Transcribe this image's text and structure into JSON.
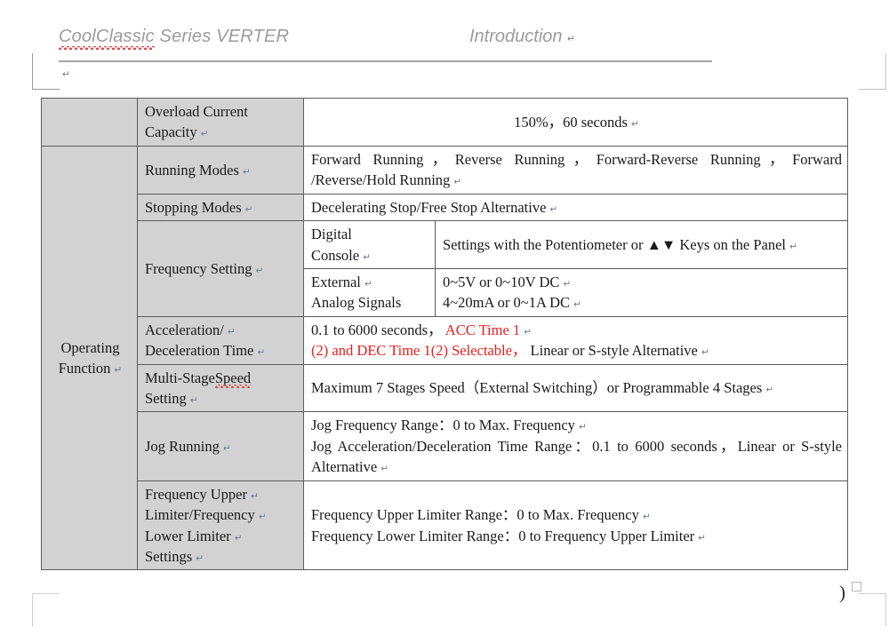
{
  "header": {
    "left_text_misspelled": "CoolClassic",
    "left_text_rest": " Series VERTER",
    "right_text": "Introduction",
    "pilcrow": "↵"
  },
  "table": {
    "row_group_label": "Operating Function",
    "rows": [
      {
        "label": "Overload Current Capacity",
        "value": "150%，60 seconds"
      },
      {
        "label": "Running Modes",
        "value": "Forward Running，Reverse Running，Forward-Reverse Running，Forward /Reverse/Hold Running"
      },
      {
        "label": "Stopping Modes",
        "value": "Decelerating Stop/Free Stop Alternative"
      },
      {
        "label": "Frequency Setting",
        "sub_rows": [
          {
            "sub_label_line1": "Digital",
            "sub_label_line2": "Console",
            "value": "Settings with the Potentiometer or ▲▼ Keys on the Panel"
          },
          {
            "sub_label_line1": "External",
            "sub_label_line2": "Analog Signals",
            "value_line1": "0~5V or 0~10V DC",
            "value_line2": "4~20mA or 0~1A DC"
          }
        ]
      },
      {
        "label_line1": "Acceleration/",
        "label_line2": "Deceleration Time",
        "value_black_1": "0.1 to 6000 seconds，",
        "value_red_1": "ACC Time 1",
        "value_red_2": "(2) and DEC Time 1(2) Selectable，",
        "value_black_2": "Linear or S-style Alternative"
      },
      {
        "label_line1_a": "Multi-Stage",
        "label_line1_b": "Speed",
        "label_line2": "Setting",
        "value": "Maximum 7 Stages Speed（External Switching）or Programmable 4 Stages"
      },
      {
        "label": "Jog Running",
        "value_line1": "Jog Frequency Range：0 to Max. Frequency",
        "value_line2": "Jog Acceleration/Deceleration Time Range：0.1 to 6000 seconds，Linear or S-style Alternative"
      },
      {
        "label_line1": "Frequency Upper",
        "label_line2": "Limiter/Frequency",
        "label_line3": "Lower Limiter",
        "label_line4": "Settings",
        "value_line1": "Frequency Upper Limiter Range：0 to Max. Frequency",
        "value_line2": "Frequency Lower Limiter Range：0 to Frequency Upper Limiter"
      }
    ]
  },
  "footer": {
    "paren_mark": ")"
  },
  "colors": {
    "shade": "#d2d2d2",
    "red_text": "#ee1c1c",
    "header_gray": "#9b9b9b",
    "border": "#5c5c5c"
  }
}
